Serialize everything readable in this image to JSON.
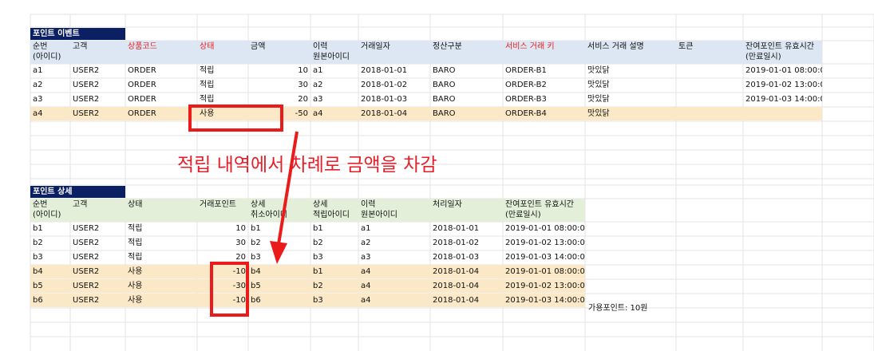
{
  "event_table": {
    "title": "포인트 이벤트",
    "headers": [
      "순번\n(아이디)",
      "고객",
      "상품코드",
      "상태",
      "금액",
      "이력\n원본아이디",
      "거래일자",
      "정산구분",
      "서비스 거래 키",
      "서비스 거래 설명",
      "토큰",
      "잔여포인트 유효시간\n(만료일시)"
    ],
    "rows": [
      [
        "a1",
        "USER2",
        "ORDER",
        "적립",
        "10",
        "a1",
        "2018-01-01",
        "BARO",
        "ORDER-B1",
        "맛있닭",
        "",
        "2019-01-01 08:00:00"
      ],
      [
        "a2",
        "USER2",
        "ORDER",
        "적립",
        "30",
        "a2",
        "2018-01-02",
        "BARO",
        "ORDER-B2",
        "맛있닭",
        "",
        "2019-01-02 13:00:00"
      ],
      [
        "a3",
        "USER2",
        "ORDER",
        "적립",
        "20",
        "a3",
        "2018-01-03",
        "BARO",
        "ORDER-B3",
        "맛있닭",
        "",
        "2019-01-03 14:00:00"
      ],
      [
        "a4",
        "USER2",
        "ORDER",
        "사용",
        "-50",
        "a4",
        "2018-01-04",
        "BARO",
        "ORDER-B4",
        "맛있닭",
        "",
        ""
      ]
    ]
  },
  "detail_table": {
    "title": "포인트 상세",
    "headers": [
      "순번\n(아이디)",
      "고객",
      "상태",
      "거래포인트",
      "상세\n취소아이디",
      "상세\n적립아이디",
      "이력\n원본아이디",
      "처리일자",
      "잔여포인트 유효시간\n(만료일시)"
    ],
    "rows": [
      [
        "b1",
        "USER2",
        "적립",
        "10",
        "b1",
        "b1",
        "a1",
        "2018-01-01",
        "2019-01-01 08:00:00"
      ],
      [
        "b2",
        "USER2",
        "적립",
        "30",
        "b2",
        "b2",
        "a2",
        "2018-01-02",
        "2019-01-02 13:00:00"
      ],
      [
        "b3",
        "USER2",
        "적립",
        "20",
        "b3",
        "b3",
        "a3",
        "2018-01-03",
        "2019-01-03 14:00:00"
      ],
      [
        "b4",
        "USER2",
        "사용",
        "-10",
        "b4",
        "b1",
        "a4",
        "2018-01-04",
        "2019-01-01 08:00:00"
      ],
      [
        "b5",
        "USER2",
        "사용",
        "-30",
        "b5",
        "b2",
        "a4",
        "2018-01-04",
        "2019-01-02 13:00:00"
      ],
      [
        "b6",
        "USER2",
        "사용",
        "-10",
        "b6",
        "b3",
        "a4",
        "2018-01-04",
        "2019-01-03 14:00:00"
      ]
    ],
    "side_note": "가용포인트: 10원"
  },
  "annotation": {
    "callout": "적립 내역에서 차례로 금액을 차감"
  },
  "colors": {
    "title_bg": "#0b1f63",
    "header_blue": "#dce7f3",
    "header_green": "#e3efd9",
    "highlight_row": "#fbe8c6",
    "accent_red": "#e52020",
    "gridline": "#e3e3e3"
  }
}
